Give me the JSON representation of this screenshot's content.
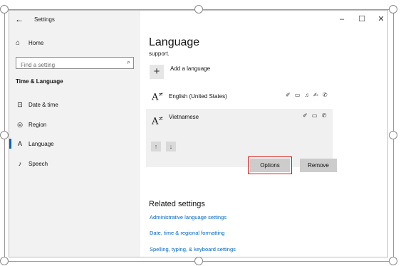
{
  "window": {
    "title": "Settings",
    "back": "←",
    "controls": {
      "minimize": "–",
      "maximize": "☐",
      "close": "✕"
    }
  },
  "sidebar": {
    "home_label": "Home",
    "search_placeholder": "Find a setting",
    "section_title": "Time & Language",
    "items": [
      {
        "label": "Date & time",
        "icon": "calendar-clock-icon",
        "glyph": "⊡"
      },
      {
        "label": "Region",
        "icon": "globe-icon",
        "glyph": "◎"
      },
      {
        "label": "Language",
        "icon": "language-icon",
        "glyph": "A"
      },
      {
        "label": "Speech",
        "icon": "microphone-icon",
        "glyph": "🎙"
      }
    ],
    "active_item": "Language"
  },
  "main": {
    "title": "Language",
    "subtitle": "support.",
    "add_language_label": "Add a language",
    "add_language_glyph": "+",
    "languages": [
      {
        "name": "English (United States)",
        "glyph": "Aⁱ",
        "feature_icons": "✐ ▭ ♫ ✍ ✆"
      },
      {
        "name": "Vietnamese",
        "glyph": "Aⁱ",
        "feature_icons": "✐ ▭ ✆"
      }
    ],
    "move_up_glyph": "↑",
    "move_down_glyph": "↓",
    "options_label": "Options",
    "remove_label": "Remove",
    "related_title": "Related settings",
    "related_links": [
      "Administrative language settings",
      "Date, time & regional formatting",
      "Spelling, typing, & keyboard settings"
    ]
  },
  "colors": {
    "accent": "#0067c0",
    "highlight_outline": "#d11b1b",
    "sidebar_bg": "#f2f2f2",
    "selected_row_bg": "#f0f0f0"
  }
}
